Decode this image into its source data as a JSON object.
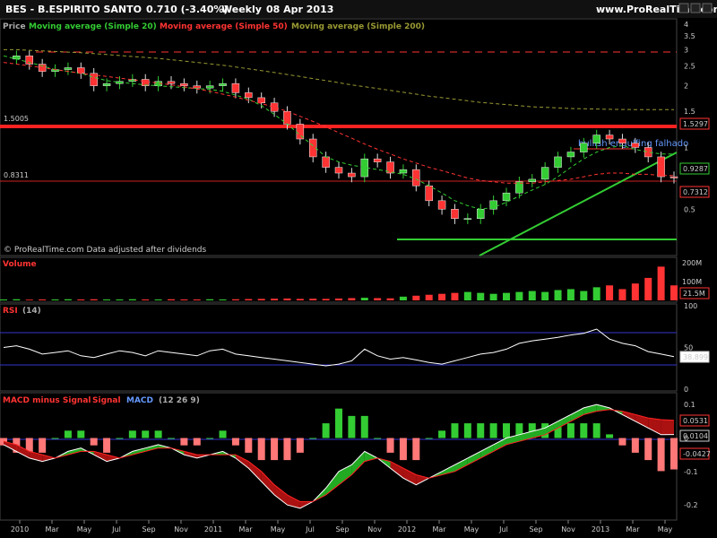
{
  "header": {
    "symbol": "BES - B.ESPIRITO SANTO",
    "price": "0.710 (-3.40%)",
    "period": "Weekly",
    "date": "08 Apr 2013",
    "site": "www.ProRealTime.com"
  },
  "price_panel": {
    "legend_price": "Price",
    "legend_ma20": "Moving average (Simple 20)",
    "legend_ma50": "Moving average (Simple 50)",
    "legend_ma200": "Moving average (Simple 200)",
    "copyright": "© ProRealTime.com  Data adjusted after dividends",
    "annotation": "bullish engulfing falhado",
    "level_left_1": "1.5005",
    "level_left_2": "0.8311",
    "tag_ma200": "1.5297",
    "tag_ma20": "0.9287",
    "tag_ma50": "0.7312"
  },
  "volume_panel": {
    "title": "Volume",
    "tag": "21.5M"
  },
  "rsi_panel": {
    "title": "RSI",
    "params": "(14)",
    "tag": "38.899"
  },
  "macd_panel": {
    "title_hist": "MACD minus Signal",
    "title_signal": "Signal",
    "title_macd": "MACD",
    "params": "(12 26 9)",
    "tag_signal": "0.0531",
    "tag_macd": "0.0104",
    "tag_hist": "-0.0427"
  },
  "colors": {
    "bg": "#000000",
    "up": "#33cc33",
    "down": "#ff3333",
    "ma20": "#33cc33",
    "ma50": "#ff3333",
    "ma200": "#999933",
    "annotation": "#6699ff",
    "rsi_line": "#ffffff",
    "band": "#3333cc"
  },
  "chart_data": [
    {
      "type": "line",
      "title": "BES - B.ESPIRITO SANTO",
      "ylim": [
        0.3,
        4.2
      ],
      "yscale": "log",
      "yticks": [
        0.5,
        1,
        1.5,
        2,
        2.5,
        3,
        3.5,
        4
      ],
      "xticks": [
        "2010",
        "Mar",
        "May",
        "Jul",
        "Sep",
        "Nov",
        "2011",
        "Mar",
        "May",
        "Jul",
        "Sep",
        "Nov",
        "2012",
        "Mar",
        "May",
        "Jul",
        "Sep",
        "Nov",
        "2013",
        "Mar",
        "May"
      ],
      "series": [
        {
          "name": "Price",
          "values": [
            2.7,
            2.8,
            2.55,
            2.35,
            2.4,
            2.45,
            2.3,
            2.0,
            2.05,
            2.1,
            2.15,
            2.0,
            2.1,
            2.05,
            2.0,
            1.95,
            2.0,
            2.05,
            1.85,
            1.75,
            1.65,
            1.5,
            1.3,
            1.1,
            0.9,
            0.8,
            0.75,
            0.72,
            0.88,
            0.85,
            0.75,
            0.78,
            0.65,
            0.55,
            0.5,
            0.45,
            0.45,
            0.5,
            0.55,
            0.6,
            0.68,
            0.7,
            0.8,
            0.9,
            0.95,
            1.05,
            1.15,
            1.1,
            1.05,
            1.0,
            0.9,
            0.72,
            0.71
          ]
        },
        {
          "name": "Moving average (Simple 20)",
          "values": [
            2.8,
            2.7,
            2.6,
            2.5,
            2.4,
            2.35,
            2.3,
            2.2,
            2.12,
            2.08,
            2.05,
            2.02,
            2.0,
            1.98,
            1.96,
            1.94,
            1.92,
            1.88,
            1.8,
            1.72,
            1.6,
            1.45,
            1.3,
            1.15,
            1.02,
            0.9,
            0.85,
            0.82,
            0.8,
            0.78,
            0.76,
            0.74,
            0.7,
            0.65,
            0.6,
            0.55,
            0.52,
            0.5,
            0.51,
            0.54,
            0.58,
            0.62,
            0.66,
            0.72,
            0.8,
            0.88,
            0.95,
            1.0,
            1.02,
            0.98,
            0.95,
            0.93,
            0.93
          ]
        },
        {
          "name": "Moving average (Simple 50)",
          "values": [
            2.6,
            2.55,
            2.5,
            2.45,
            2.4,
            2.35,
            2.3,
            2.26,
            2.22,
            2.18,
            2.14,
            2.1,
            2.06,
            2.02,
            1.98,
            1.93,
            1.88,
            1.82,
            1.76,
            1.7,
            1.64,
            1.57,
            1.5,
            1.42,
            1.34,
            1.26,
            1.18,
            1.11,
            1.04,
            0.98,
            0.93,
            0.88,
            0.84,
            0.8,
            0.77,
            0.74,
            0.71,
            0.69,
            0.68,
            0.67,
            0.67,
            0.67,
            0.68,
            0.69,
            0.7,
            0.72,
            0.74,
            0.75,
            0.75,
            0.74,
            0.74,
            0.73,
            0.73
          ]
        },
        {
          "name": "Moving average (Simple 200)",
          "values": [
            3.0,
            3.0,
            2.98,
            2.96,
            2.94,
            2.92,
            2.9,
            2.87,
            2.84,
            2.81,
            2.78,
            2.75,
            2.72,
            2.68,
            2.64,
            2.6,
            2.56,
            2.52,
            2.47,
            2.42,
            2.37,
            2.32,
            2.27,
            2.22,
            2.17,
            2.12,
            2.07,
            2.02,
            1.98,
            1.94,
            1.9,
            1.86,
            1.82,
            1.78,
            1.75,
            1.72,
            1.69,
            1.66,
            1.64,
            1.62,
            1.6,
            1.58,
            1.57,
            1.56,
            1.55,
            1.545,
            1.54,
            1.535,
            1.533,
            1.531,
            1.53,
            1.53,
            1.53
          ]
        }
      ]
    },
    {
      "type": "bar",
      "title": "Volume",
      "ylim": [
        0,
        220
      ],
      "yticks": [
        "200M",
        "100M"
      ],
      "values": [
        5,
        6,
        4,
        5,
        5,
        6,
        5,
        6,
        5,
        5,
        6,
        5,
        5,
        6,
        5,
        5,
        6,
        5,
        6,
        7,
        8,
        9,
        10,
        8,
        9,
        8,
        10,
        12,
        14,
        12,
        11,
        20,
        25,
        30,
        35,
        40,
        45,
        40,
        35,
        40,
        45,
        50,
        45,
        55,
        60,
        50,
        70,
        80,
        60,
        90,
        120,
        180,
        80
      ]
    },
    {
      "type": "line",
      "title": "RSI",
      "ylim": [
        0,
        100
      ],
      "yticks": [
        0,
        50,
        100
      ],
      "series": [
        {
          "name": "RSI",
          "values": [
            50,
            52,
            48,
            42,
            44,
            46,
            40,
            38,
            42,
            46,
            44,
            40,
            46,
            44,
            42,
            40,
            46,
            48,
            42,
            40,
            38,
            36,
            34,
            32,
            30,
            28,
            30,
            34,
            48,
            40,
            36,
            38,
            35,
            32,
            30,
            34,
            38,
            42,
            44,
            48,
            55,
            58,
            60,
            62,
            65,
            67,
            72,
            60,
            55,
            52,
            45,
            42,
            39
          ]
        }
      ]
    },
    {
      "type": "line",
      "title": "MACD minus Signal Signal MACD",
      "ylim": [
        -0.24,
        0.13
      ],
      "yticks": [
        0.1,
        0,
        -0.1,
        -0.2
      ],
      "series": [
        {
          "name": "MACD",
          "values": [
            -0.02,
            -0.04,
            -0.06,
            -0.07,
            -0.06,
            -0.04,
            -0.03,
            -0.05,
            -0.07,
            -0.06,
            -0.04,
            -0.03,
            -0.02,
            -0.03,
            -0.05,
            -0.06,
            -0.05,
            -0.04,
            -0.06,
            -0.09,
            -0.13,
            -0.17,
            -0.2,
            -0.21,
            -0.19,
            -0.15,
            -0.1,
            -0.08,
            -0.04,
            -0.06,
            -0.09,
            -0.12,
            -0.14,
            -0.12,
            -0.1,
            -0.08,
            -0.06,
            -0.04,
            -0.02,
            0.0,
            0.01,
            0.02,
            0.03,
            0.05,
            0.07,
            0.09,
            0.1,
            0.09,
            0.07,
            0.05,
            0.03,
            0.01,
            0.0104
          ]
        },
        {
          "name": "Signal",
          "values": [
            -0.01,
            -0.02,
            -0.04,
            -0.05,
            -0.06,
            -0.05,
            -0.04,
            -0.04,
            -0.05,
            -0.06,
            -0.05,
            -0.04,
            -0.03,
            -0.03,
            -0.04,
            -0.05,
            -0.05,
            -0.05,
            -0.05,
            -0.07,
            -0.1,
            -0.14,
            -0.17,
            -0.19,
            -0.19,
            -0.17,
            -0.14,
            -0.11,
            -0.07,
            -0.06,
            -0.07,
            -0.09,
            -0.11,
            -0.12,
            -0.11,
            -0.1,
            -0.08,
            -0.06,
            -0.04,
            -0.02,
            -0.01,
            0.0,
            0.01,
            0.03,
            0.05,
            0.07,
            0.08,
            0.085,
            0.08,
            0.07,
            0.06,
            0.055,
            0.0531
          ]
        },
        {
          "name": "MACD minus Signal",
          "values": [
            -0.01,
            -0.02,
            -0.02,
            -0.02,
            0.0,
            0.01,
            0.01,
            -0.01,
            -0.02,
            0.0,
            0.01,
            0.01,
            0.01,
            0.0,
            -0.01,
            -0.01,
            0.0,
            0.01,
            -0.01,
            -0.02,
            -0.03,
            -0.03,
            -0.03,
            -0.02,
            0.0,
            0.02,
            0.04,
            0.03,
            0.03,
            0.0,
            -0.02,
            -0.03,
            -0.03,
            0.0,
            0.01,
            0.02,
            0.02,
            0.02,
            0.02,
            0.02,
            0.02,
            0.02,
            0.02,
            0.02,
            0.02,
            0.02,
            0.02,
            0.005,
            -0.01,
            -0.02,
            -0.03,
            -0.045,
            -0.0427
          ]
        }
      ]
    }
  ]
}
